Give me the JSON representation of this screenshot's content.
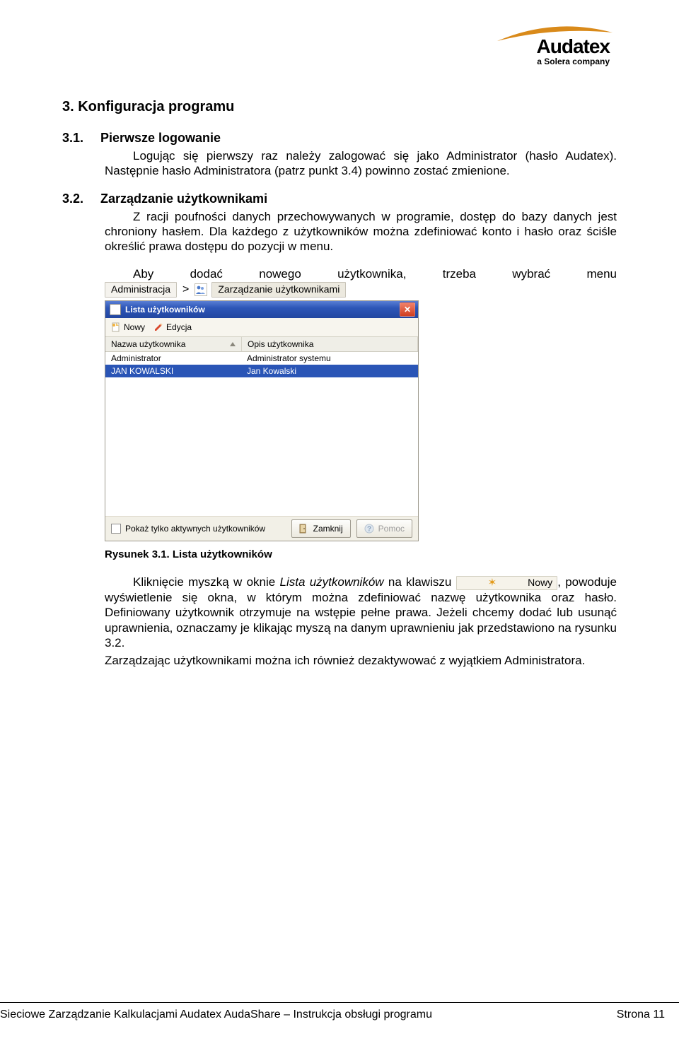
{
  "logo": {
    "brand": "Audatex",
    "tagline": "a Solera company"
  },
  "h_main": "3. Konfiguracja programu",
  "sec31": {
    "num": "3.1.",
    "title": "Pierwsze logowanie",
    "p1": "Logując się pierwszy raz należy zalogować się jako Administrator (hasło Audatex). Następnie hasło Administratora (patrz punkt 3.4) powinno zostać zmienione."
  },
  "sec32": {
    "num": "3.2.",
    "title": "Zarządzanie użytkownikami",
    "p1": "Z racji poufności danych przechowywanych w programie, dostęp do bazy danych jest chroniony hasłem. Dla każdego z użytkowników można zdefiniować konto i hasło oraz ściśle określić prawa dostępu do pozycji w menu.",
    "p2_lead": "Aby dodać nowego użytkownika, trzeba wybrać menu",
    "menu_admin": "Administracja",
    "menu_users": "Zarządzanie użytkownikami"
  },
  "win": {
    "title": "Lista użytkowników",
    "tb_new": "Nowy",
    "tb_edit": "Edycja",
    "col_user": "Nazwa użytkownika",
    "col_desc": "Opis użytkownika",
    "rows": [
      {
        "u": "Administrator",
        "d": "Administrator systemu",
        "sel": false
      },
      {
        "u": "JAN KOWALSKI",
        "d": "Jan Kowalski",
        "sel": true
      }
    ],
    "chk_label": "Pokaż tylko aktywnych użytkowników",
    "btn_close": "Zamknij",
    "btn_help": "Pomoc"
  },
  "caption": "Rysunek 3.1. Lista użytkowników",
  "after": {
    "line1_a": "Kliknięcie myszką w oknie ",
    "line1_italic": "Lista użytkowników",
    "line1_b": " na klawiszu ",
    "nowy_label": "Nowy",
    "line1_c": ", powoduje wyświetlenie się okna, w którym można zdefiniować nazwę użytkownika oraz hasło. Definiowany użytkownik otrzymuje na wstępie pełne prawa. Jeżeli chcemy dodać lub usunąć uprawnienia, oznaczamy je klikając myszą na danym uprawnieniu jak przedstawiono na rysunku 3.2.",
    "p2": "Zarządzając użytkownikami można ich również dezaktywować z wyjątkiem Administratora."
  },
  "footer": {
    "left": "Sieciowe Zarządzanie Kalkulacjami Audatex AudaShare  – Instrukcja obsługi programu",
    "right": "Strona 11"
  }
}
